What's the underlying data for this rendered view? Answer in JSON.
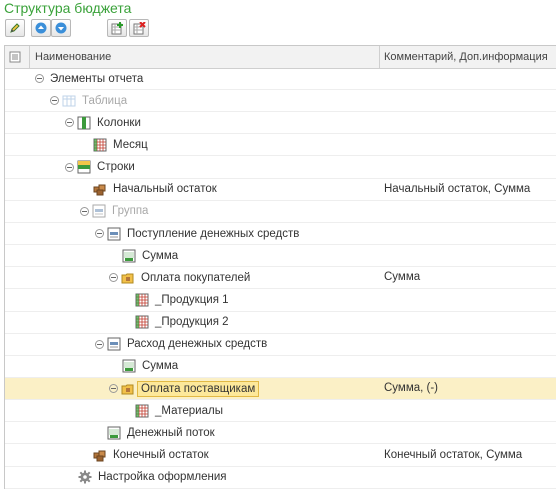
{
  "title": "Структура бюджета",
  "toolbar": {
    "buttons": [
      "edit-icon",
      "move-up-icon",
      "move-down-icon",
      "add-icon",
      "delete-icon"
    ]
  },
  "columns": {
    "name": "Наименование",
    "comment": "Комментарий, Доп.информация"
  },
  "rows": [
    {
      "label": "Элементы отчета",
      "comment": "",
      "icon": "none",
      "expander": true
    },
    {
      "label": "Таблица",
      "comment": "",
      "icon": "table-icon",
      "expander": true,
      "dim": true
    },
    {
      "label": "Колонки",
      "comment": "",
      "icon": "columns-icon",
      "expander": true
    },
    {
      "label": "Месяц",
      "comment": "",
      "icon": "grid-icon"
    },
    {
      "label": "Строки",
      "comment": "",
      "icon": "rows-icon",
      "expander": true
    },
    {
      "label": "Начальный остаток",
      "comment": "Начальный остаток, Сумма",
      "icon": "cubes-icon"
    },
    {
      "label": "Группа",
      "comment": "",
      "icon": "group-icon",
      "expander": true,
      "dim": true
    },
    {
      "label": "Поступление денежных средств",
      "comment": "",
      "icon": "group-icon",
      "expander": true
    },
    {
      "label": "Сумма",
      "comment": "",
      "icon": "sum-icon"
    },
    {
      "label": "Оплата покупателей",
      "comment": "Сумма",
      "icon": "folder-cubes-icon",
      "expander": true
    },
    {
      "label": "_Продукция 1",
      "comment": "",
      "icon": "grid-icon"
    },
    {
      "label": "_Продукция 2",
      "comment": "",
      "icon": "grid-icon"
    },
    {
      "label": "Расход денежных средств",
      "comment": "",
      "icon": "group-icon",
      "expander": true
    },
    {
      "label": "Сумма",
      "comment": "",
      "icon": "sum-icon"
    },
    {
      "label": "Оплата поставщикам",
      "comment": "Сумма, (-)",
      "icon": "folder-cubes-icon",
      "expander": true,
      "selected": true
    },
    {
      "label": "_Материалы",
      "comment": "",
      "icon": "grid-icon"
    },
    {
      "label": "Денежный поток",
      "comment": "",
      "icon": "sum-icon"
    },
    {
      "label": "Конечный остаток",
      "comment": "Конечный остаток, Сумма",
      "icon": "cubes-icon"
    },
    {
      "label": "Настройка оформления",
      "comment": "",
      "icon": "gear-icon"
    }
  ]
}
